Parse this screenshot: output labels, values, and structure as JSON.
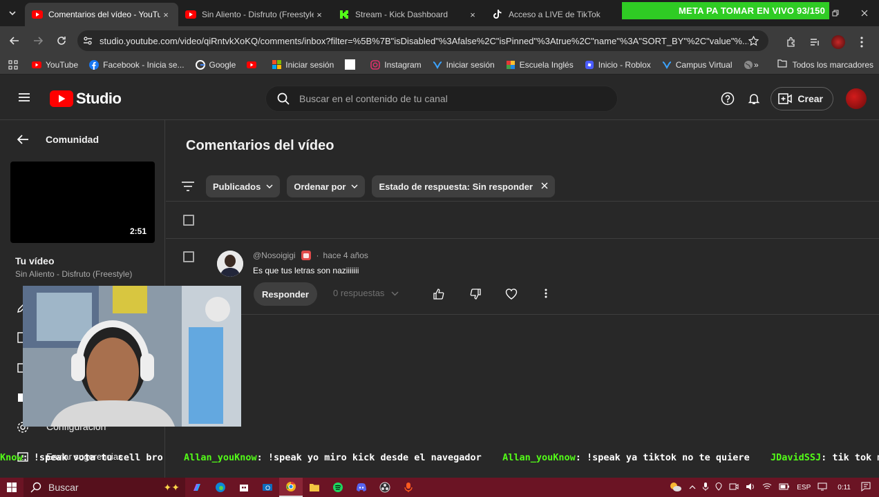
{
  "browser": {
    "tabs": [
      {
        "title": "Comentarios del vídeo - YouTube",
        "active": true,
        "favicon": "youtube-icon"
      },
      {
        "title": "Sin Aliento - Disfruto (Freestyle)",
        "active": false,
        "favicon": "youtube-icon"
      },
      {
        "title": "Stream - Kick Dashboard",
        "active": false,
        "favicon": "kick-icon"
      },
      {
        "title": "Acceso a LIVE de TikTok",
        "active": false,
        "favicon": "tiktok-icon"
      }
    ],
    "close_glyph": "×",
    "url": "studio.youtube.com/video/qiRntvkXoKQ/comments/inbox?filter=%5B%7B\"isDisabled\"%3Afalse%2C\"isPinned\"%3Atrue%2C\"name\"%3A\"SORT_BY\"%2C\"value\"%...",
    "bookmarks": [
      {
        "label": "YouTube",
        "icon": "youtube-icon"
      },
      {
        "label": "Facebook - Inicia se...",
        "icon": "facebook-icon"
      },
      {
        "label": "Google",
        "icon": "google-icon"
      },
      {
        "label": "",
        "icon": "youtube-icon"
      },
      {
        "label": "Iniciar sesión",
        "icon": "microsoft-icon"
      },
      {
        "label": "",
        "icon": "blank-page-icon"
      },
      {
        "label": "Instagram",
        "icon": "instagram-icon"
      },
      {
        "label": "Iniciar sesión",
        "icon": "campus-icon"
      },
      {
        "label": "Escuela Inglés",
        "icon": "school-icon"
      },
      {
        "label": "Inicio - Roblox",
        "icon": "roblox-icon"
      },
      {
        "label": "Campus Virtual",
        "icon": "campus-icon"
      },
      {
        "label": "",
        "icon": "globe-icon"
      }
    ],
    "bookmarks_more": "»",
    "all_bookmarks": "Todos los marcadores"
  },
  "overlay_banner": "META PA TOMAR EN VIVO 93/150",
  "studio": {
    "logo_text": "Studio",
    "search_placeholder": "Buscar en el contenido de tu canal",
    "create_label": "Crear",
    "sidebar": {
      "back_label": "Comunidad",
      "video_duration": "2:51",
      "your_video_label": "Tu vídeo",
      "video_title": "Sin Aliento - Disfruto (Freestyle)",
      "settings_label": "Configuración",
      "feedback_label": "Enviar sugerencias"
    },
    "page_title": "Comentarios del vídeo",
    "filters": [
      {
        "label": "Publicados",
        "type": "dropdown"
      },
      {
        "label": "Ordenar por",
        "type": "dropdown"
      },
      {
        "label": "Estado de respuesta: Sin responder",
        "type": "removable"
      }
    ],
    "comment": {
      "author": "@Nosoigigi",
      "separator": "·",
      "time": "hace 4 años",
      "text": "Es que tus letras son naziiiiiii",
      "reply_label": "Responder",
      "replies_label": "0 respuestas"
    }
  },
  "chat_ticker": [
    {
      "user": "Know",
      "message": ": !speak vota tu cell bro"
    },
    {
      "user": "Allan_youKnow",
      "message": ": !speak yo miro kick desde el navegador"
    },
    {
      "user": "Allan_youKnow",
      "message": ": !speak ya tiktok no te quiere"
    },
    {
      "user": "JDavidSSJ",
      "message": ": tik tok marik"
    }
  ],
  "taskbar": {
    "search_label": "Buscar",
    "language": "ESP",
    "time": "0:11"
  },
  "colors": {
    "youtube_red": "#ff0000",
    "kick_green": "#53fc18",
    "banner_green": "#2fcc24",
    "taskbar": "#6b1424"
  }
}
